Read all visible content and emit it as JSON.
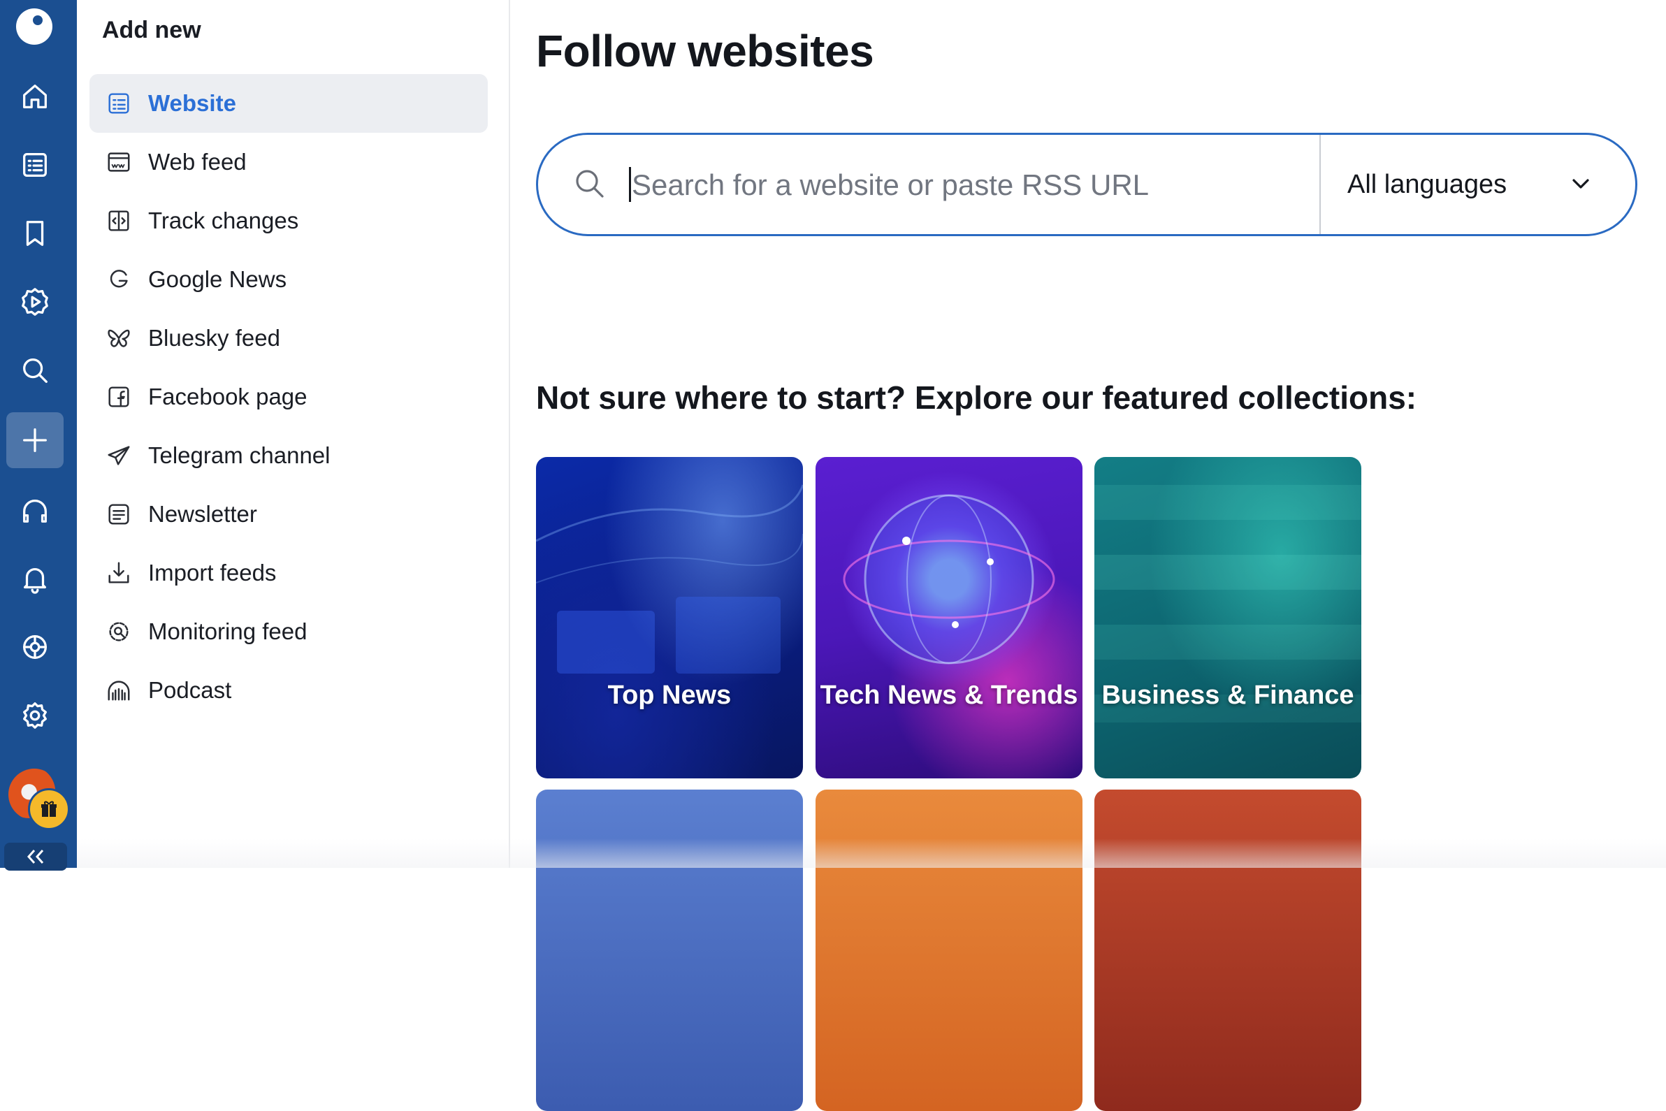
{
  "rail": {
    "items": [
      {
        "icon": "home-icon"
      },
      {
        "icon": "feeds-list-icon"
      },
      {
        "icon": "bookmark-icon"
      },
      {
        "icon": "video-icon"
      },
      {
        "icon": "search-icon"
      },
      {
        "icon": "add-icon",
        "active": true
      },
      {
        "icon": "headphones-icon"
      },
      {
        "icon": "bell-icon"
      },
      {
        "icon": "integrations-icon"
      },
      {
        "icon": "settings-icon"
      }
    ],
    "brand_color": "#1b4f91"
  },
  "panel": {
    "title": "Add new",
    "items": [
      {
        "label": "Website",
        "icon": "website-icon",
        "active": true
      },
      {
        "label": "Web feed",
        "icon": "web-feed-icon"
      },
      {
        "label": "Track changes",
        "icon": "track-changes-icon"
      },
      {
        "label": "Google News",
        "icon": "google-icon"
      },
      {
        "label": "Bluesky feed",
        "icon": "butterfly-icon"
      },
      {
        "label": "Facebook page",
        "icon": "facebook-icon"
      },
      {
        "label": "Telegram channel",
        "icon": "telegram-icon"
      },
      {
        "label": "Newsletter",
        "icon": "newsletter-icon"
      },
      {
        "label": "Import feeds",
        "icon": "import-icon"
      },
      {
        "label": "Monitoring feed",
        "icon": "monitoring-icon"
      },
      {
        "label": "Podcast",
        "icon": "podcast-icon"
      }
    ],
    "accent_color": "#2b6fd6"
  },
  "main": {
    "title": "Follow websites",
    "search": {
      "placeholder": "Search for a website or paste RSS URL",
      "value": ""
    },
    "language_select": {
      "selected": "All languages"
    },
    "featured_heading": "Not sure where to start? Explore our featured collections:",
    "collections": [
      {
        "label": "Top News"
      },
      {
        "label": "Tech News & Trends"
      },
      {
        "label": "Business & Finance"
      }
    ]
  }
}
